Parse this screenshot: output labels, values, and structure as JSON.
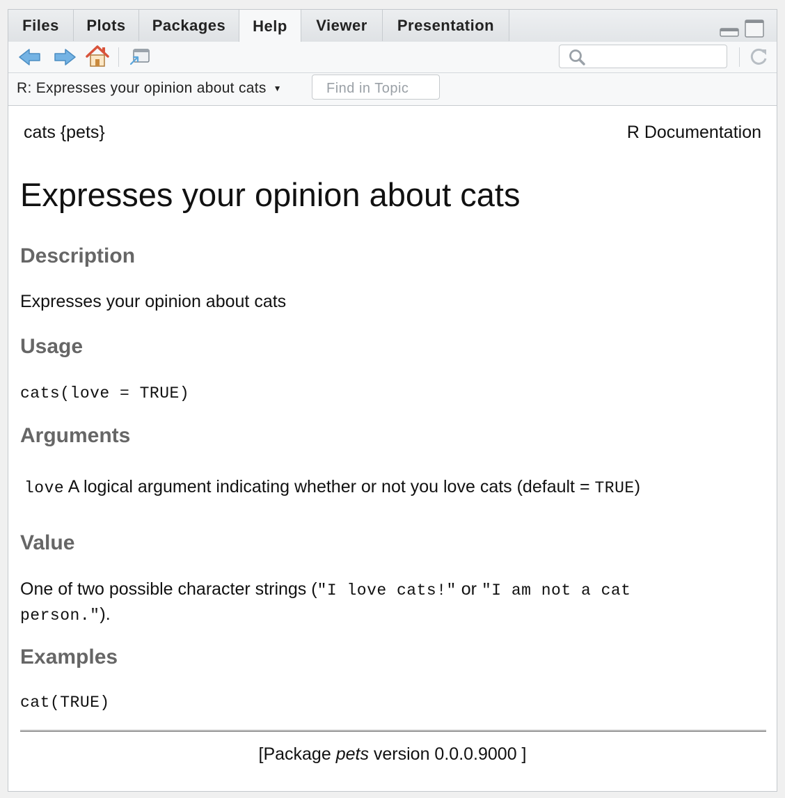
{
  "tabs": [
    {
      "label": "Files",
      "active": false
    },
    {
      "label": "Plots",
      "active": false
    },
    {
      "label": "Packages",
      "active": false
    },
    {
      "label": "Help",
      "active": true
    },
    {
      "label": "Viewer",
      "active": false
    },
    {
      "label": "Presentation",
      "active": false
    }
  ],
  "toolbar": {
    "icons": [
      "back-arrow-icon",
      "forward-arrow-icon",
      "home-icon",
      "show-in-new-window-icon",
      "search-icon",
      "refresh-icon"
    ],
    "search_value": ""
  },
  "topic_bar": {
    "topic": "R: Expresses your opinion about cats",
    "find_placeholder": "Find in Topic"
  },
  "doc": {
    "topic_package": "cats {pets}",
    "r_documentation": "R Documentation",
    "title": "Expresses your opinion about cats",
    "description_heading": "Description",
    "description_text": "Expresses your opinion about cats",
    "usage_heading": "Usage",
    "usage_code": "cats(love = TRUE)",
    "arguments_heading": "Arguments",
    "arg_name": "love",
    "arg_desc_before": "A logical argument indicating whether or not you love cats (default = ",
    "arg_desc_code": "TRUE",
    "arg_desc_after": ")",
    "value_heading": "Value",
    "value_text_1": "One of two possible character strings (",
    "value_code_1": "\"I love cats!\"",
    "value_text_2": " or ",
    "value_code_2a": "\"I am not a cat",
    "value_code_2b": "person.\"",
    "value_text_3": ").",
    "examples_heading": "Examples",
    "examples_code": "cat(TRUE)",
    "footer_before": "[Package ",
    "footer_pkg": "pets",
    "footer_after": " version 0.0.0.9000 ]"
  },
  "colors": {
    "heading_gray": "#666666",
    "arrow_blue": "#5aa6dc",
    "home_red": "#d9533b"
  }
}
